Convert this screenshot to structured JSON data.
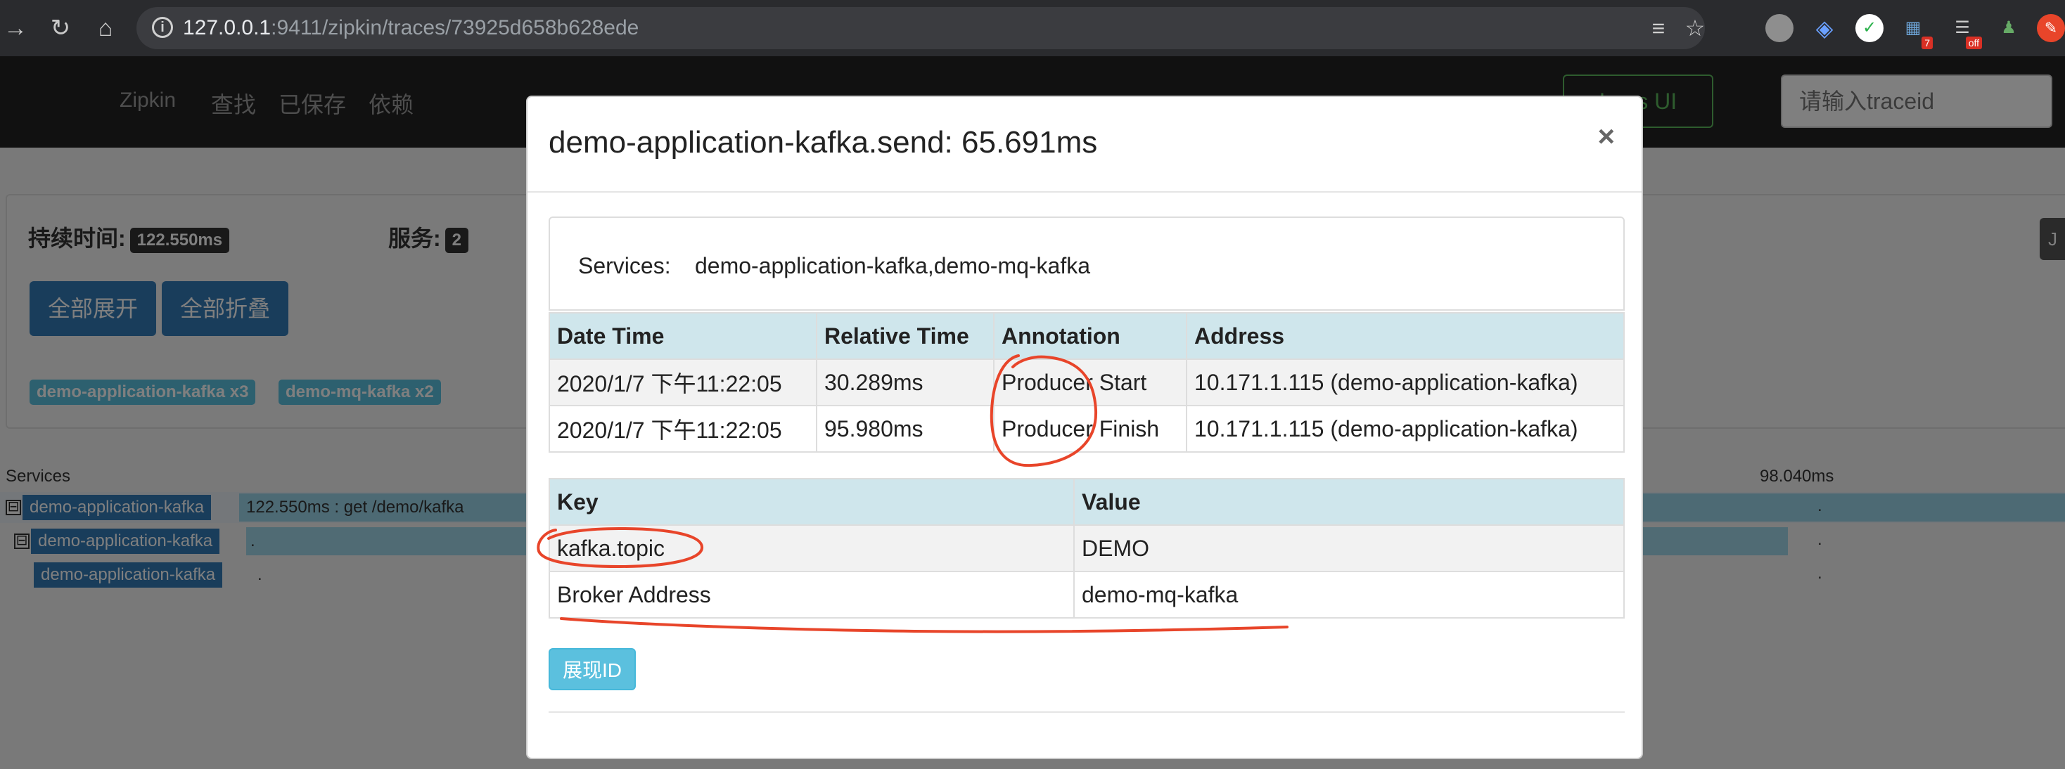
{
  "browser": {
    "url_host": "127.0.0.1",
    "url_rest": ":9411/zipkin/traces/73925d658b628ede",
    "extension_badge_1": "7",
    "extension_badge_2": "off"
  },
  "app": {
    "brand": "Zipkin",
    "nav": [
      "查找",
      "已保存",
      "依赖"
    ],
    "lens_button": "Lens UI",
    "trace_input_placeholder": "请输入traceid"
  },
  "trace_summary": {
    "duration_label": "持续时间:",
    "duration_value": "122.550ms",
    "services_label": "服务:",
    "services_value": "2",
    "expand_all": "全部展开",
    "collapse_all": "全部折叠",
    "service_tags": [
      "demo-application-kafka x3",
      "demo-mq-kafka x2"
    ],
    "side_handle": "J"
  },
  "trace_view": {
    "services_header": "Services",
    "timeline_tick": "98.040ms",
    "rows": [
      {
        "service": "demo-application-kafka",
        "desc": "122.550ms : get /demo/kafka",
        "toggle": "⊟"
      },
      {
        "service": "demo-application-kafka",
        "desc": ".",
        "toggle": "⊟"
      },
      {
        "service": "demo-application-kafka",
        "desc": ".",
        "toggle": ""
      }
    ],
    "row_end_dot": "."
  },
  "modal": {
    "title": "demo-application-kafka.send: 65.691ms",
    "close": "×",
    "services_key": "Services:",
    "services_value": "demo-application-kafka,demo-mq-kafka",
    "annotation_headers": [
      "Date Time",
      "Relative Time",
      "Annotation",
      "Address"
    ],
    "annotations": [
      {
        "date": "2020/1/7 下午11:22:05",
        "relative": "30.289ms",
        "annotation": "Producer Start",
        "address": "10.171.1.115 (demo-application-kafka)"
      },
      {
        "date": "2020/1/7 下午11:22:05",
        "relative": "95.980ms",
        "annotation": "Producer Finish",
        "address": "10.171.1.115 (demo-application-kafka)"
      }
    ],
    "tag_headers": [
      "Key",
      "Value"
    ],
    "tags": [
      {
        "key": "kafka.topic",
        "value": "DEMO"
      },
      {
        "key": "Broker Address",
        "value": "demo-mq-kafka"
      }
    ],
    "show_id_button": "展现ID"
  },
  "colors": {
    "primary": "#337ab7",
    "info": "#5bc0de",
    "success": "#5cb85c",
    "table_header": "#cfe6ec",
    "annotation_marker": "#e8452a"
  }
}
